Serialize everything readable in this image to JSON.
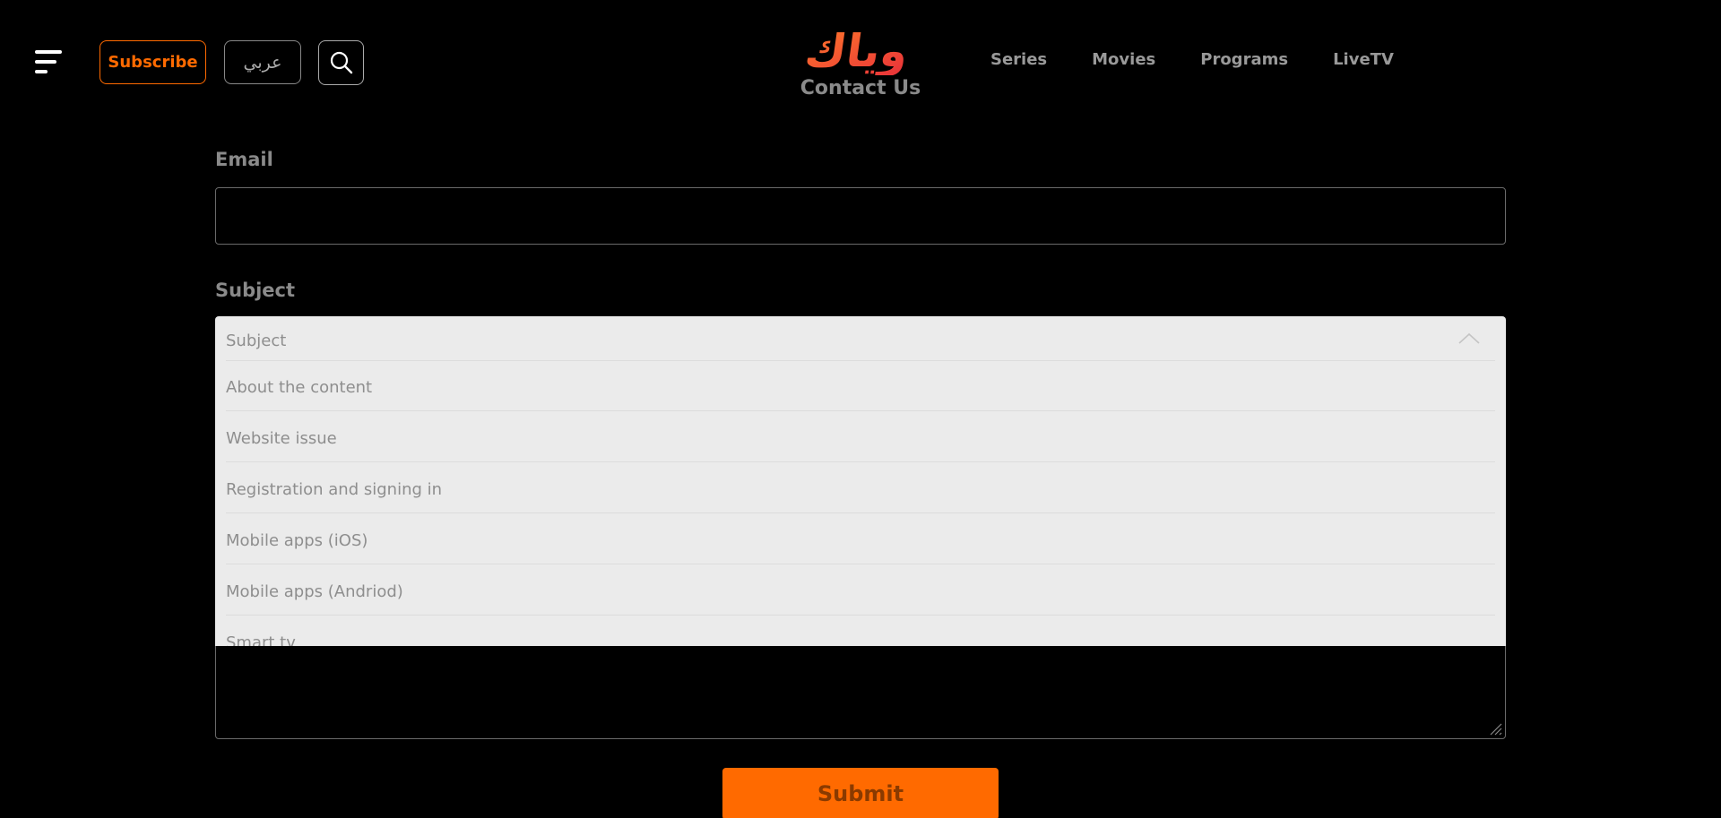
{
  "header": {
    "subscribe_label": "Subscribe",
    "language_label": "عربي",
    "logo_text": "وياك",
    "page_title": "Contact Us",
    "nav": [
      "Series",
      "Movies",
      "Programs",
      "LiveTV"
    ]
  },
  "form": {
    "email_label": "Email",
    "email_value": "",
    "subject_label": "Subject",
    "subject_placeholder": "Subject",
    "subject_options": [
      "About the content",
      "Website issue",
      "Registration and signing in",
      "Mobile apps (iOS)",
      "Mobile apps (Andriod)",
      "Smart tv"
    ],
    "submit_label": "Submit"
  },
  "colors": {
    "accent": "#ff6a00",
    "logo": "#f0532b",
    "background": "#000000",
    "dropdown_bg": "#ebebeb"
  },
  "icons": {
    "menu": "hamburger-icon",
    "search": "search-icon",
    "dropdown_toggle": "chevron-up-icon"
  }
}
